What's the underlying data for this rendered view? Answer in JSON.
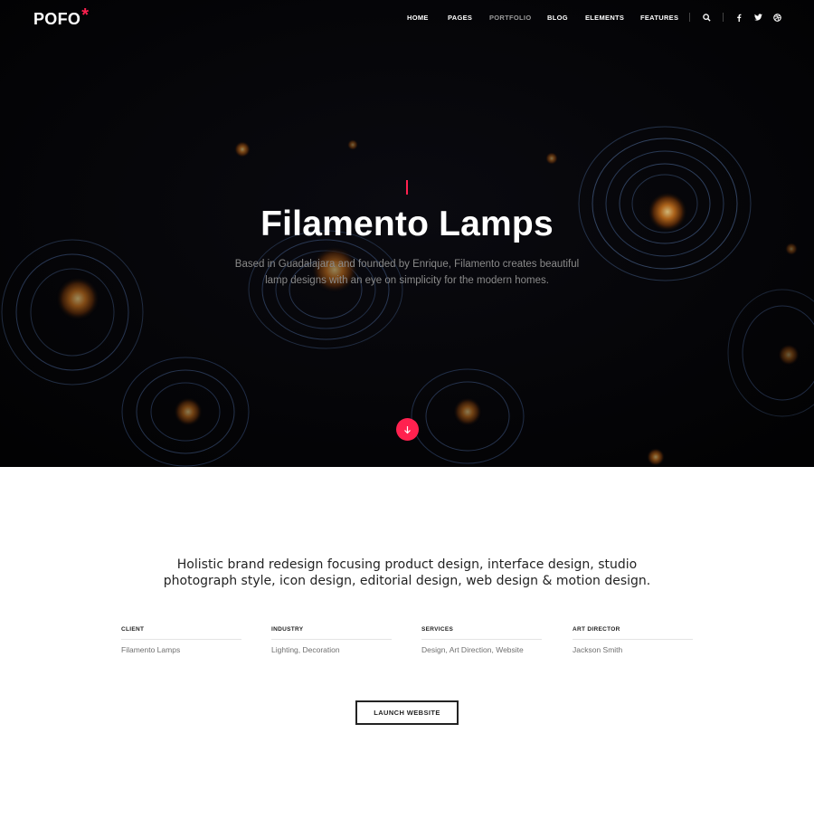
{
  "brand": {
    "logo_text": "POFO",
    "logo_mark": "*",
    "accent_color": "#ff214f"
  },
  "nav": {
    "items": [
      {
        "label": "HOME"
      },
      {
        "label": "PAGES"
      },
      {
        "label": "PORTFOLIO"
      },
      {
        "label": "BLOG"
      },
      {
        "label": "ELEMENTS"
      },
      {
        "label": "FEATURES"
      }
    ],
    "active": "PORTFOLIO",
    "icons": [
      "search-icon",
      "facebook-icon",
      "twitter-icon",
      "dribbble-icon"
    ]
  },
  "hero": {
    "title": "Filamento Lamps",
    "subtitle_line1": "Based in Guadalajara and founded by Enrique, Filamento creates beautiful",
    "subtitle_line2": "lamp designs with an eye on simplicity for the modern homes.",
    "scroll_icon": "arrow-down-icon"
  },
  "project": {
    "intro_line1": "Holistic brand redesign focusing product design, interface design, studio",
    "intro_line2": "photograph style, icon design, editorial design, web design & motion design.",
    "details": [
      {
        "label": "CLIENT",
        "value": "Filamento Lamps"
      },
      {
        "label": "INDUSTRY",
        "value": "Lighting, Decoration"
      },
      {
        "label": "SERVICES",
        "value": "Design, Art Direction, Website"
      },
      {
        "label": "ART DIRECTOR",
        "value": "Jackson Smith"
      }
    ],
    "launch_label": "LAUNCH WEBSITE"
  }
}
